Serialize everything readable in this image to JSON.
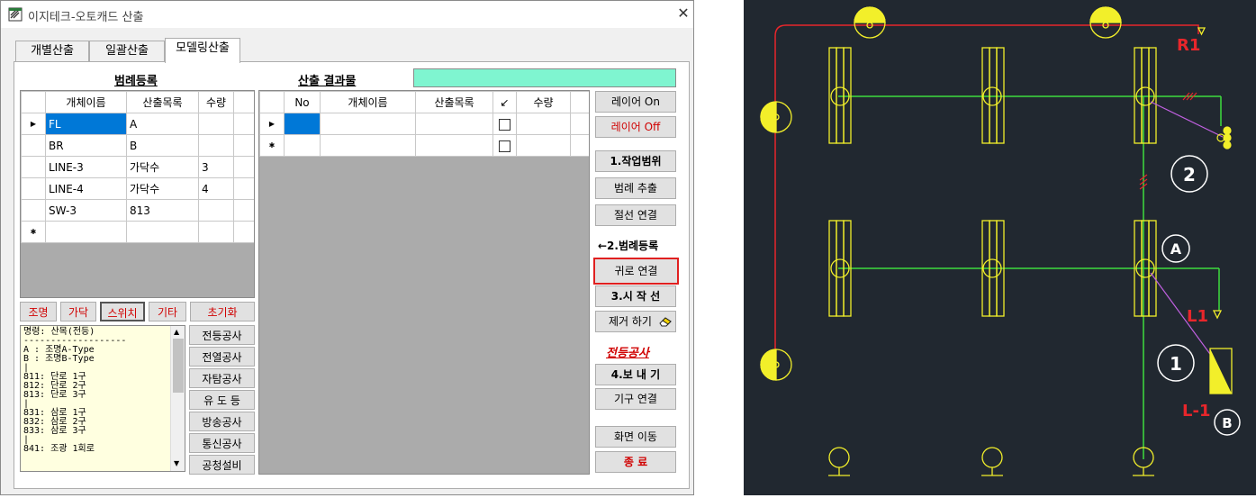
{
  "window": {
    "title": "이지테크-오토캐드 산출",
    "close_glyph": "✕"
  },
  "tabs": [
    {
      "label": "개별산출"
    },
    {
      "label": "일괄산출"
    },
    {
      "label": "모델링산출"
    }
  ],
  "legend_section": {
    "title": "범례등록",
    "columns": [
      "개체이름",
      "산출목록",
      "수량"
    ],
    "rows": [
      {
        "name": "FL",
        "item": "A",
        "qty": ""
      },
      {
        "name": "BR",
        "item": "B",
        "qty": ""
      },
      {
        "name": "LINE-3",
        "item": "가닥수",
        "qty": "3"
      },
      {
        "name": "LINE-4",
        "item": "가닥수",
        "qty": "4"
      },
      {
        "name": "SW-3",
        "item": "813",
        "qty": ""
      }
    ]
  },
  "result_section": {
    "title": "산출 결과물",
    "columns": [
      "No",
      "개체이름",
      "산출목록",
      "↙",
      "수량"
    ]
  },
  "filter_buttons": {
    "lighting": "조명",
    "strand": "가닥",
    "switch": "스위치",
    "etc": "기타",
    "reset": "초기화"
  },
  "command_text": "명령: 산목(전등)\n-------------------\nA : 조명A-Type\nB : 조명B-Type\n|\n811: 단로 1구\n812: 단로 2구\n813: 단로 3구\n|\n831: 삼로 1구\n832: 삼로 2구\n833: 삼로 3구\n|\n841: 조광 1회로",
  "work_types": [
    "전등공사",
    "전열공사",
    "자탐공사",
    "유 도 등",
    "방송공사",
    "통신공사",
    "공청설비"
  ],
  "side_buttons": {
    "layer_on": "레이어 On",
    "layer_off": "레이어 Off",
    "work_range": "1.작업범위",
    "legend_extract": "범례 추출",
    "cut_connect": "절선 연결",
    "legend_register": "←2.범례등록",
    "return_connect": "귀로 연결",
    "start_line": "3.시 작 선",
    "remove": "제거 하기",
    "current_work": "전등공사",
    "export": "4.보 내 기",
    "fixture_connect": "기구 연결",
    "move_screen": "화면 이동",
    "exit": "종 료"
  },
  "cad_labels": {
    "r1": "R1",
    "two": "2",
    "a": "A",
    "l1": "L1",
    "one": "1",
    "l_1": "L-1",
    "b": "B"
  },
  "colors": {
    "selected": "#0078d7",
    "result_bar": "#7ff5d0",
    "cad_bg": "#212830",
    "cad_red": "#e8262b",
    "cad_green": "#3ddc3d",
    "cad_yellow": "#f2ef2a",
    "cad_purple": "#c060e0",
    "highlight_border": "#e02020"
  }
}
